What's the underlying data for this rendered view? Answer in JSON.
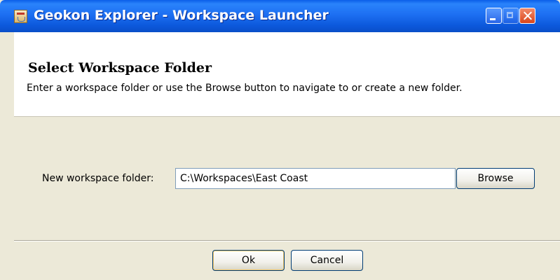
{
  "window": {
    "title": "Geokon Explorer - Workspace Launcher"
  },
  "header": {
    "title": "Select Workspace Folder",
    "description": "Enter a workspace folder or use the Browse button to navigate to or create a new folder."
  },
  "form": {
    "folder_label": "New workspace folder:",
    "folder_value": "C:\\Workspaces\\East Coast",
    "browse_label": "Browse"
  },
  "buttons": {
    "ok_label": "Ok",
    "cancel_label": "Cancel"
  },
  "icons": {
    "app": "java-app-icon",
    "minimize": "minimize-icon",
    "maximize": "maximize-icon",
    "close": "close-icon"
  },
  "colors": {
    "titlebar": "#1d6ff2",
    "dialog_background": "#ece9d8",
    "header_background": "#ffffff",
    "close_button": "#d9451b"
  }
}
